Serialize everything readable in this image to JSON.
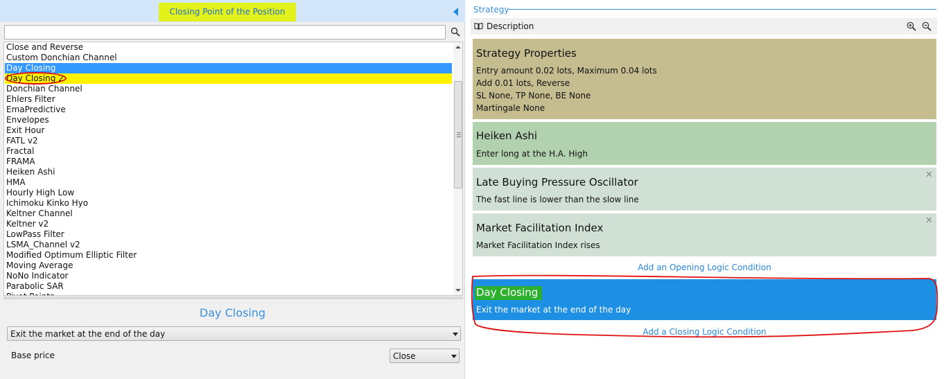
{
  "left_panel": {
    "header_title": "Closing Point of the Position",
    "search": {
      "value": "",
      "placeholder": ""
    },
    "indicator_list": [
      "Close and Reverse",
      "Custom Donchian Channel",
      "Day Closing",
      "Day Closing 2",
      "Donchian Channel",
      "Ehlers Filter",
      "EmaPredictive",
      "Envelopes",
      "Exit Hour",
      "FATL v2",
      "Fractal",
      "FRAMA",
      "Heiken Ashi",
      "HMA",
      "Hourly High Low",
      "Ichimoku Kinko Hyo",
      "Keltner Channel",
      "Keltner v2",
      "LowPass Filter",
      "LSMA_Channel v2",
      "Modified Optimum Elliptic Filter",
      "Moving Average",
      "NoNo Indicator",
      "Parabolic SAR",
      "Pivot Points"
    ],
    "selected_item": "Day Closing",
    "marked_item": "Day Closing 2",
    "indicator_name": "Day Closing",
    "logic_select_value": "Exit the market at the end of the day",
    "base_price_label": "Base price",
    "base_price_value": "Close"
  },
  "right_panel": {
    "section_label": "Strategy",
    "toolbar_description": "Description",
    "strategy_properties": {
      "title": "Strategy Properties",
      "lines": [
        "Entry amount 0.02 lots, Maximum 0.04 lots",
        "Add 0.01 lots, Reverse",
        "SL None,  TP None,  BE None",
        "Martingale None"
      ]
    },
    "opening_slots": [
      {
        "title": "Heiken Ashi",
        "description": "Enter long at the H.A. High",
        "removable": false
      },
      {
        "title": "Late Buying Pressure Oscillator",
        "description": "The fast line is lower than the slow line",
        "removable": true
      },
      {
        "title": "Market Facilitation Index",
        "description": "Market Facilitation Index rises",
        "removable": true
      }
    ],
    "close_glyph": "✕",
    "add_opening_label": "Add an Opening Logic Condition",
    "closing_slot": {
      "title": "Day Closing",
      "description": "Exit the market at the end of the day"
    },
    "add_closing_label": "Add a Closing Logic Condition"
  },
  "colors": {
    "header_bg": "#d3e6fa",
    "highlight_yellow": "#e3f21a",
    "accent_blue": "#3a8fdc",
    "selection_blue": "#3399ff",
    "props_bg": "#c5bd90",
    "heiken_bg": "#b2d1ae",
    "slot_bg": "#d0e0d5",
    "closing_slot_bg": "#1e90e3",
    "annotation_red": "#e01010"
  },
  "icons": [
    "search-icon",
    "collapse-arrow-icon",
    "book-icon",
    "zoom-in-icon",
    "zoom-out-icon",
    "close-icon"
  ]
}
